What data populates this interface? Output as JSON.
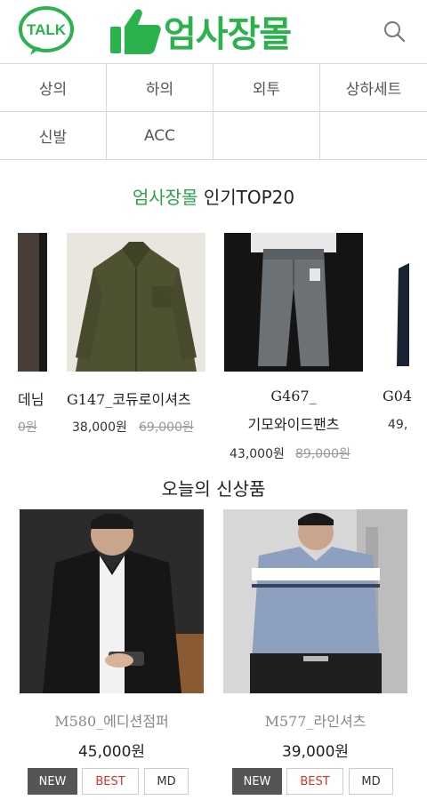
{
  "header": {
    "talk_label": "TALK",
    "brand": "엄사장몰",
    "brand_color": "#2bb24c"
  },
  "categories": [
    "상의",
    "하의",
    "외투",
    "상하세트",
    "신발",
    "ACC"
  ],
  "top_section": {
    "title_accent": "엄사장몰",
    "title_rest": " 인기TOP20",
    "products": [
      {
        "name": "데님",
        "old_price": "0원"
      },
      {
        "name": "G147_코듀로이셔츠",
        "price": "38,000원",
        "old_price": "69,000원"
      },
      {
        "name_line1": "G467_",
        "name_line2": "기모와이드팬츠",
        "price": "43,000원",
        "old_price": "89,000원"
      },
      {
        "name": "G04",
        "price": "49,"
      }
    ]
  },
  "new_section": {
    "title": "오늘의 신상품",
    "products": [
      {
        "name": "M580_에디션점퍼",
        "price": "45,000원",
        "tags": [
          "NEW",
          "BEST",
          "MD"
        ]
      },
      {
        "name": "M577_라인셔츠",
        "price": "39,000원",
        "tags": [
          "NEW",
          "BEST",
          "MD"
        ]
      }
    ]
  }
}
